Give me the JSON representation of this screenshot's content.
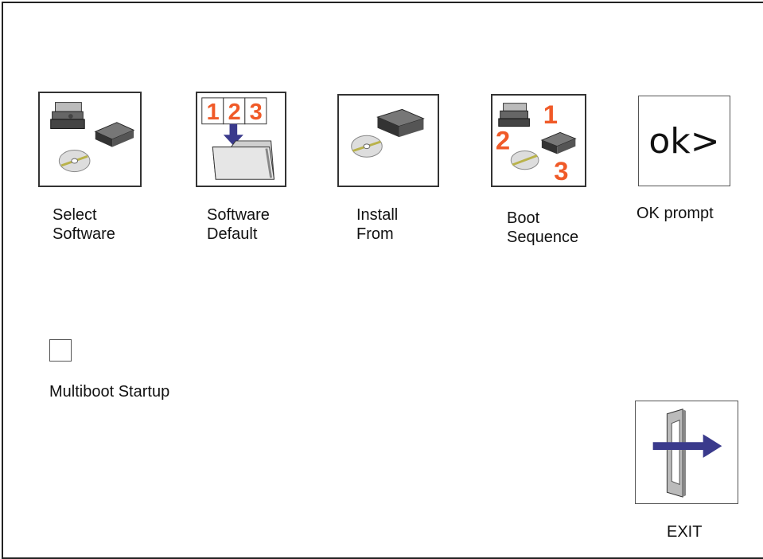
{
  "menu": {
    "items": [
      {
        "line1": "Select",
        "line2": "Software",
        "icon": "drives-and-cd-icon"
      },
      {
        "line1": "Software",
        "line2": "Default",
        "icon": "numbered-folder-icon"
      },
      {
        "line1": "Install",
        "line2": "From",
        "icon": "cd-and-drive-icon"
      },
      {
        "line1": "Boot",
        "line2": "Sequence",
        "icon": "boot-order-icon"
      },
      {
        "label": "OK prompt",
        "tile_text": "ok>",
        "icon": "ok-prompt-icon"
      }
    ]
  },
  "multiboot": {
    "label": "Multiboot Startup",
    "checked": false
  },
  "exit": {
    "label": "EXIT",
    "icon": "exit-door-icon"
  },
  "colors": {
    "number_orange": "#f05a28",
    "arrow_blue": "#3a3a8c",
    "frame": "#222222"
  }
}
